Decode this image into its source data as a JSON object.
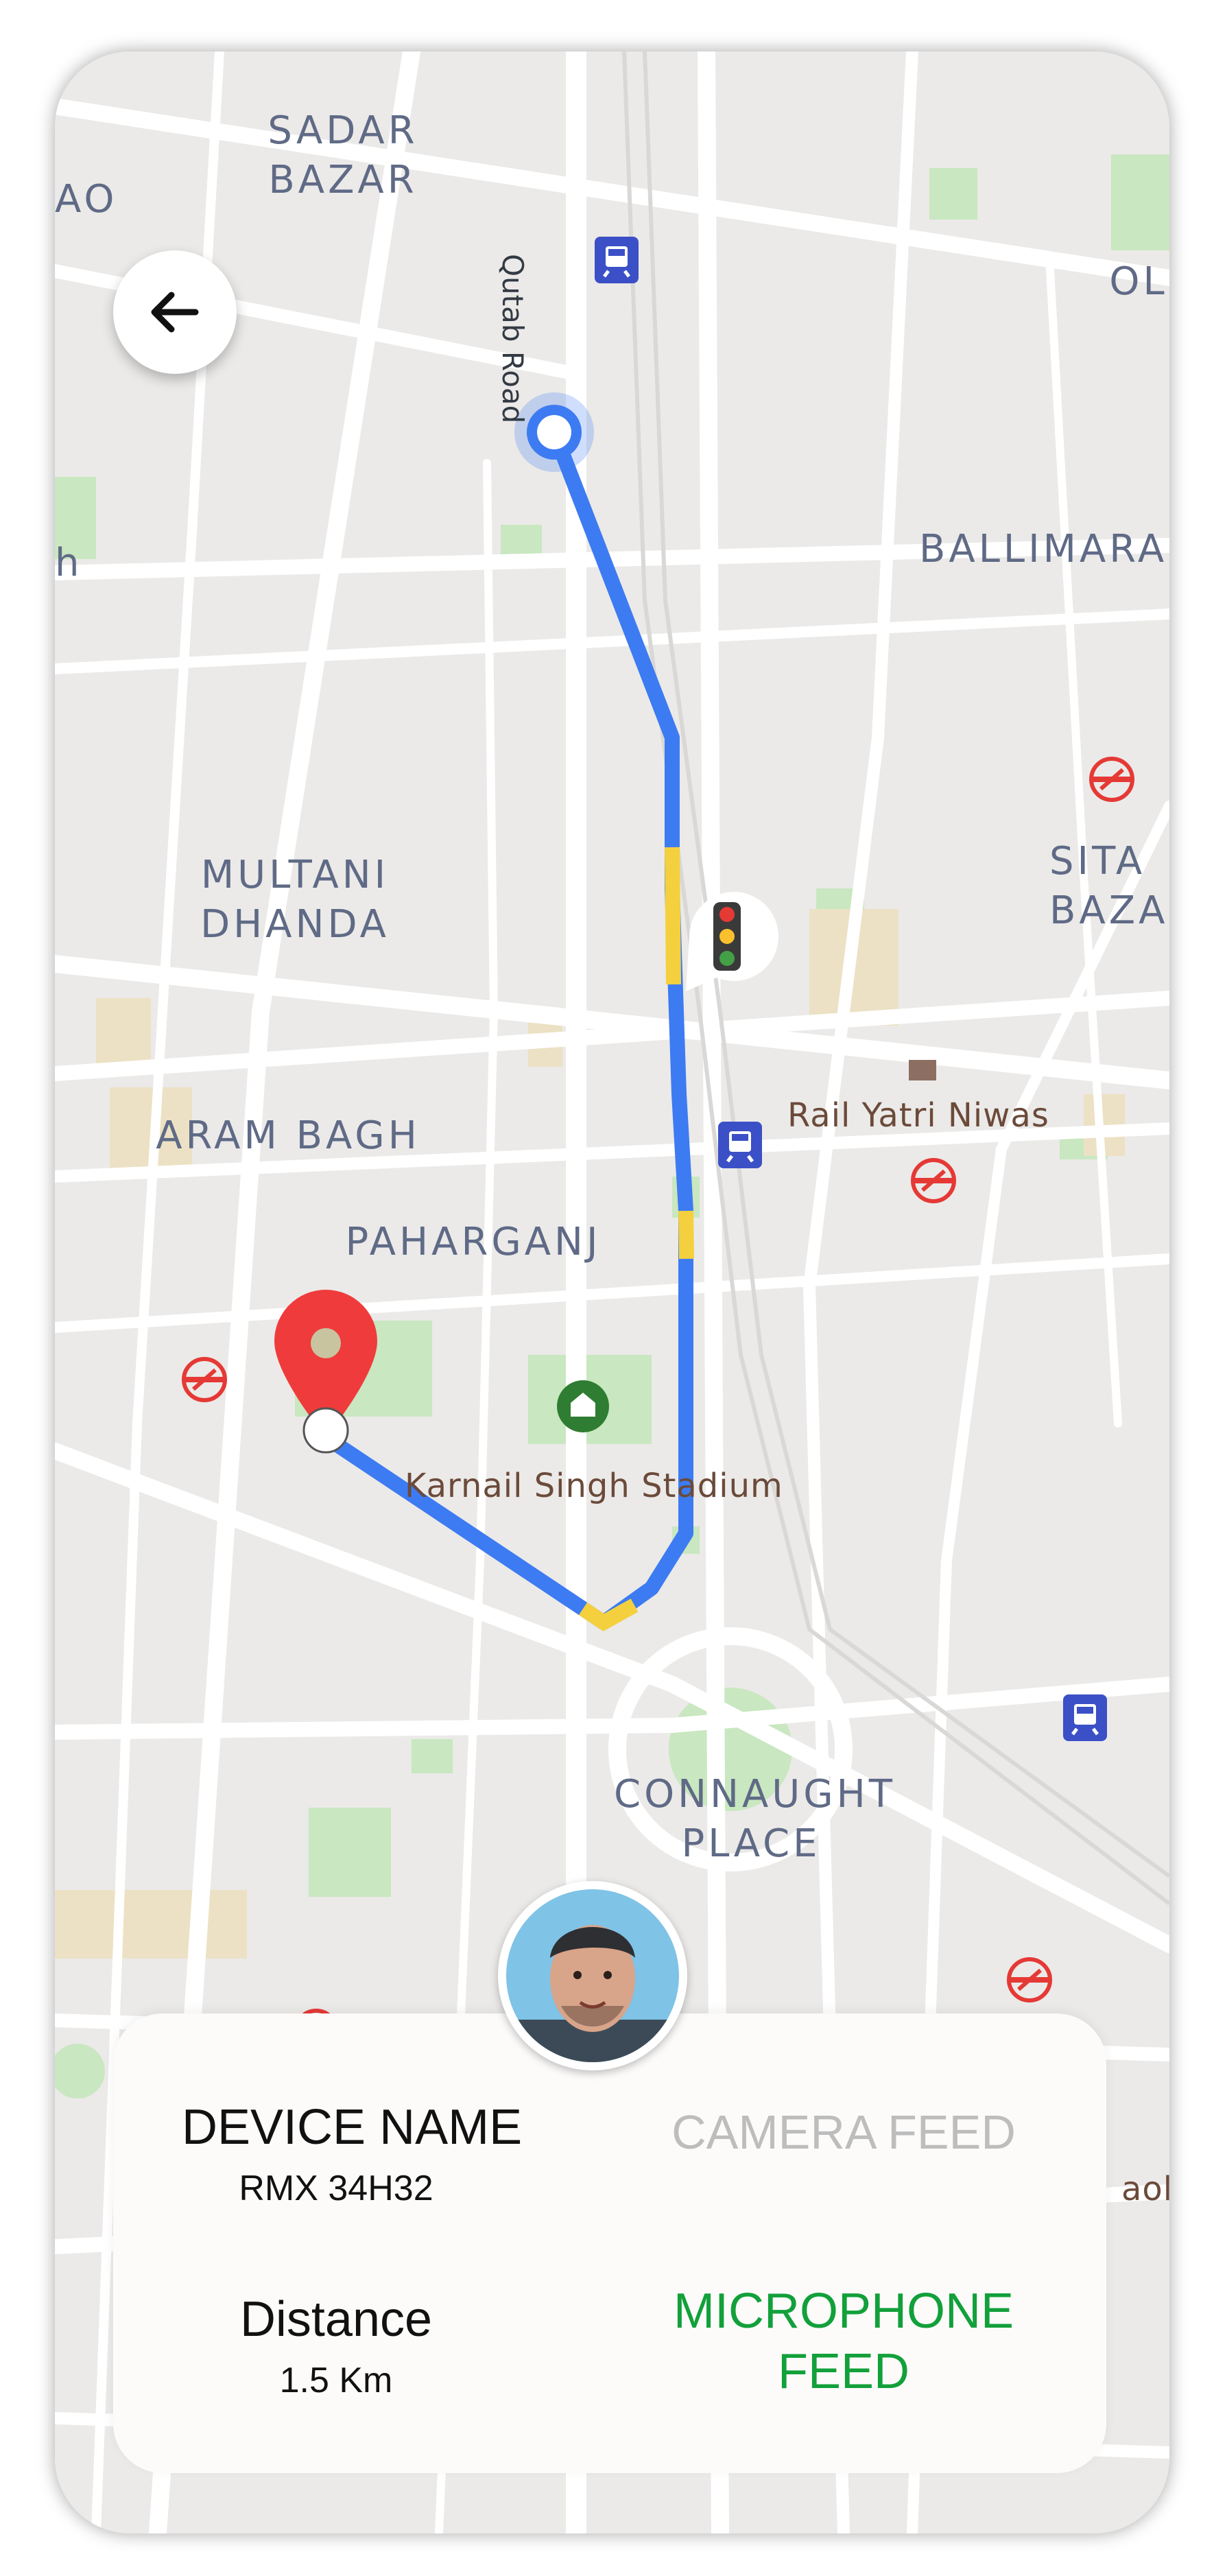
{
  "map": {
    "labels": {
      "sadar_bazar": "SADAR\nBAZAR",
      "ao": "AO",
      "ol": "OL",
      "h": "h",
      "ballimaran": "BALLIMARAN",
      "multani_dhanda": "MULTANI\nDHANDA",
      "sita_bazar": "SITA\nBAZA",
      "rail_yatri_niwas": "Rail Yatri Niwas",
      "aram_bagh": "ARAM BAGH",
      "paharganj": "PAHARGANJ",
      "karnail_singh_stadium": "Karnail Singh Stadium",
      "connaught_place": "CONNAUGHT\nPLACE",
      "aoli": "aoli"
    },
    "road_name": "Qutab Road",
    "route_color": "#3d7bf2",
    "traffic_color": "#f4d03f",
    "destination_pin_color": "#ef3b3b"
  },
  "header": {
    "back_icon": "arrow-left-icon"
  },
  "card": {
    "device_name_label": "DEVICE NAME",
    "device_name_value": "RMX 34H32",
    "distance_label": "Distance",
    "distance_value": "1.5 Km",
    "camera_feed_label": "CAMERA FEED",
    "microphone_feed_label": "MICROPHONE\nFEED",
    "camera_feed_color": "#bdbdbd",
    "microphone_feed_color": "#12a03a"
  }
}
